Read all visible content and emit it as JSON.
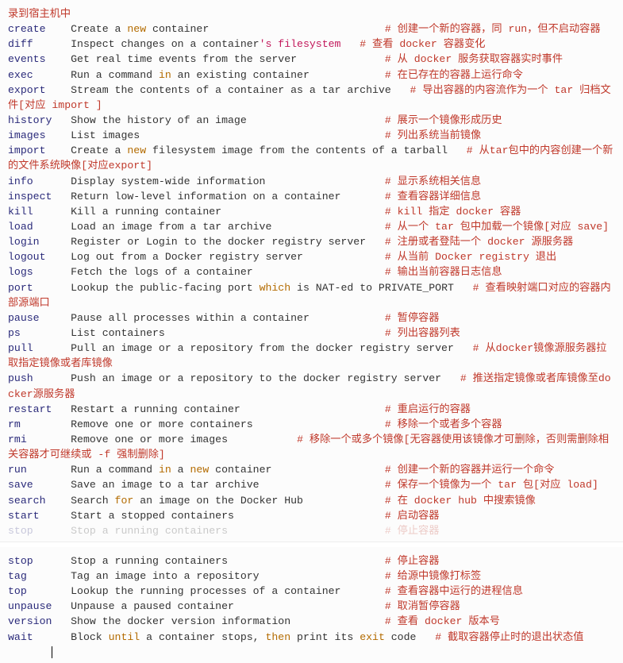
{
  "block1_header": "录到宿主机中",
  "lines": [
    {
      "cmd": "create",
      "kw": "",
      "desc_pre": "Create a ",
      "desc_kw": "new",
      "desc_post": " container",
      "comment": "# 创建一个新的容器，同 run，但不启动容器"
    },
    {
      "cmd": "diff",
      "kw": "",
      "desc_pre": "Inspect changes on a container",
      "desc_str": "'s filesystem",
      "desc_post": "",
      "comment": "# 查看 docker 容器变化",
      "col2": 42
    },
    {
      "cmd": "events",
      "desc_pre": "Get real time events from the server",
      "comment": "# 从 docker 服务获取容器实时事件"
    },
    {
      "cmd": "exec",
      "desc_pre": "Run a command ",
      "desc_kw": "in",
      "desc_post": " an existing container",
      "comment": "# 在已存在的容器上运行命令"
    },
    {
      "cmd": "export",
      "desc_pre": "Stream the contents of a container as a tar archive",
      "comment": "# 导出容器的内容流作为一个 tar 归档文件[对应 import ]",
      "wrap": true
    },
    {
      "cmd": "history",
      "desc_pre": "Show the history of an image",
      "comment": "# 展示一个镜像形成历史"
    },
    {
      "cmd": "images",
      "desc_pre": "List images",
      "comment": "# 列出系统当前镜像"
    },
    {
      "cmd": "import",
      "desc_pre": "Create a ",
      "desc_kw": "new",
      "desc_post": " filesystem image from the contents of a tarball",
      "comment": "# 从tar包中的内容创建一个新的文件系统映像[对应export]",
      "wrap": true
    },
    {
      "cmd": "info",
      "desc_pre": "Display system-wide information",
      "comment": "# 显示系统相关信息"
    },
    {
      "cmd": "inspect",
      "desc_pre": "Return low-level information on a container",
      "comment": "# 查看容器详细信息"
    },
    {
      "cmd": "kill",
      "desc_pre": "Kill a running container",
      "comment": "# kill 指定 docker 容器"
    },
    {
      "cmd": "load",
      "desc_pre": "Load an image from a tar archive",
      "comment": "# 从一个 tar 包中加载一个镜像[对应 save]"
    },
    {
      "cmd": "login",
      "desc_pre": "Register or Login to the docker registry server",
      "comment": "# 注册或者登陆一个 docker 源服务器"
    },
    {
      "cmd": "logout",
      "desc_pre": "Log out from a Docker registry server",
      "comment": "# 从当前 Docker registry 退出"
    },
    {
      "cmd": "logs",
      "desc_pre": "Fetch the logs of a container",
      "comment": "# 输出当前容器日志信息"
    },
    {
      "cmd": "port",
      "desc_pre": "Lookup the public-facing port ",
      "desc_kw": "which",
      "desc_post": " is NAT-ed to PRIVATE_PORT",
      "comment": "# 查看映射端口对应的容器内部源端口",
      "wrap": true
    },
    {
      "cmd": "pause",
      "desc_pre": "Pause all processes within a container",
      "comment": "# 暂停容器"
    },
    {
      "cmd": "ps",
      "desc_pre": "List containers",
      "comment": "# 列出容器列表"
    },
    {
      "cmd": "pull",
      "desc_pre": "Pull an image or a repository from the docker registry server",
      "comment": "# 从docker镜像源服务器拉取指定镜像或者库镜像",
      "wrap": true
    },
    {
      "cmd": "push",
      "desc_pre": "Push an image or a repository to the docker registry server",
      "comment": "# 推送指定镜像或者库镜像至docker源服务器",
      "wrap": true
    },
    {
      "cmd": "restart",
      "desc_pre": "Restart a running container",
      "comment": "# 重启运行的容器"
    },
    {
      "cmd": "rm",
      "desc_pre": "Remove one or more containers",
      "comment": "# 移除一个或者多个容器"
    },
    {
      "cmd": "rmi",
      "desc_pre": "Remove one or more images",
      "comment": "# 移除一个或多个镜像[无容器使用该镜像才可删除，否则需删除相关容器才可继续或 -f 强制删除]",
      "wrap": true,
      "col2": 36
    },
    {
      "cmd": "run",
      "desc_pre": "Run a command ",
      "desc_kw": "in",
      "desc_post": " a ",
      "desc_kw2": "new",
      "desc_post2": " container",
      "comment": "# 创建一个新的容器并运行一个命令"
    },
    {
      "cmd": "save",
      "desc_pre": "Save an image to a tar archive",
      "comment": "# 保存一个镜像为一个 tar 包[对应 load]"
    },
    {
      "cmd": "search",
      "desc_pre": "Search ",
      "desc_kw": "for",
      "desc_post": " an image on the Docker Hub",
      "comment": "# 在 docker hub 中搜索镜像"
    },
    {
      "cmd": "start",
      "desc_pre": "Start a stopped containers",
      "comment": "# 启动容器"
    }
  ],
  "truncated": {
    "cmd": "stop",
    "desc_pre": "Stop a running containers",
    "comment": "# 停止容器"
  },
  "lines2": [
    {
      "cmd": "stop",
      "desc_pre": "Stop a running containers",
      "comment": "# 停止容器"
    },
    {
      "cmd": "tag",
      "desc_pre": "Tag an image into a repository",
      "comment": "# 给源中镜像打标签"
    },
    {
      "cmd": "top",
      "desc_pre": "Lookup the running processes of a container",
      "comment": "# 查看容器中运行的进程信息"
    },
    {
      "cmd": "unpause",
      "desc_pre": "Unpause a paused container",
      "comment": "# 取消暂停容器"
    },
    {
      "cmd": "version",
      "desc_pre": "Show the docker version information",
      "comment": "# 查看 docker 版本号"
    },
    {
      "cmd": "wait",
      "desc_pre": "Block ",
      "desc_kw": "until",
      "desc_post": " a container stops, ",
      "desc_kw2": "then",
      "desc_post2": " print its ",
      "desc_kw3": "exit",
      "desc_post3": " code",
      "comment": "# 截取容器停止时的退出状态值"
    }
  ]
}
